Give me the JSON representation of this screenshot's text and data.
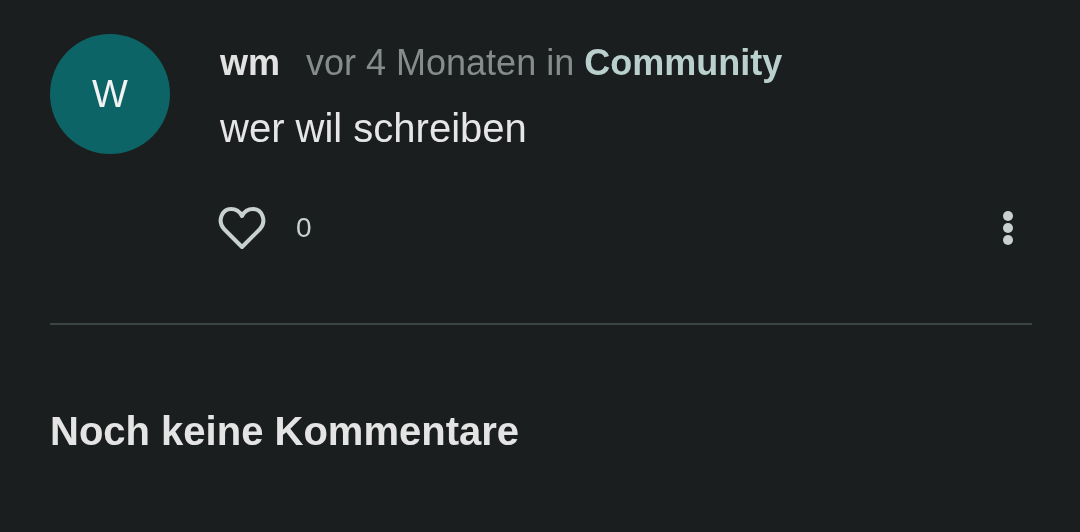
{
  "post": {
    "avatar_letter": "W",
    "author": "wm",
    "time": "vor 4 Monaten",
    "preposition": "in",
    "category": "Community",
    "text": "wer wil schreiben",
    "liked": false,
    "like_count": "0"
  },
  "comments": {
    "empty_message": "Noch keine Kommentare"
  }
}
